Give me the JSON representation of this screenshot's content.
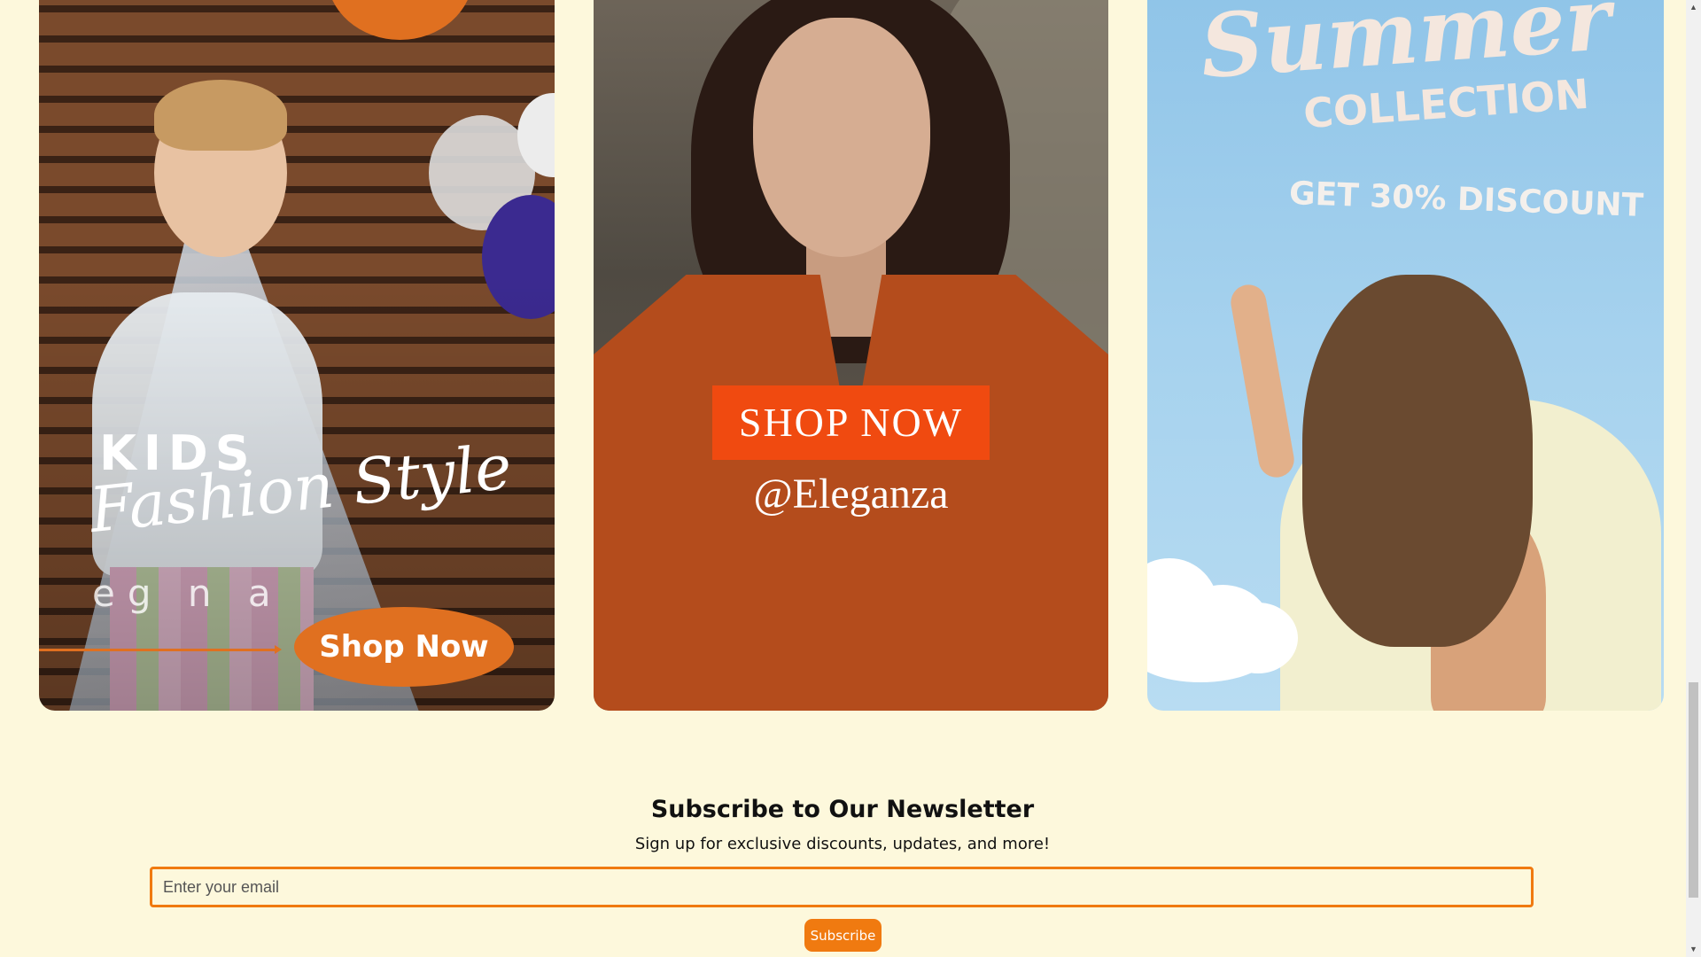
{
  "cards": [
    {
      "kids_label": "KIDS",
      "fashion_label": "Fashion Style",
      "brand_label": "eg n a",
      "shop_label": "Shop Now"
    },
    {
      "shop_label": "SHOP NOW",
      "handle": "@Eleganza"
    },
    {
      "summer_label": "Summer",
      "collection_label": "COLLECTION",
      "discount_label": "GET 30% DISCOUNT"
    }
  ],
  "newsletter": {
    "title": "Subscribe to Our Newsletter",
    "subtitle": "Sign up for exclusive discounts, updates, and more!",
    "email_placeholder": "Enter your email",
    "subscribe_label": "Subscribe"
  },
  "colors": {
    "page_bg": "#fdf8dc",
    "accent": "#f07a10",
    "shop_red": "#f04a10"
  }
}
